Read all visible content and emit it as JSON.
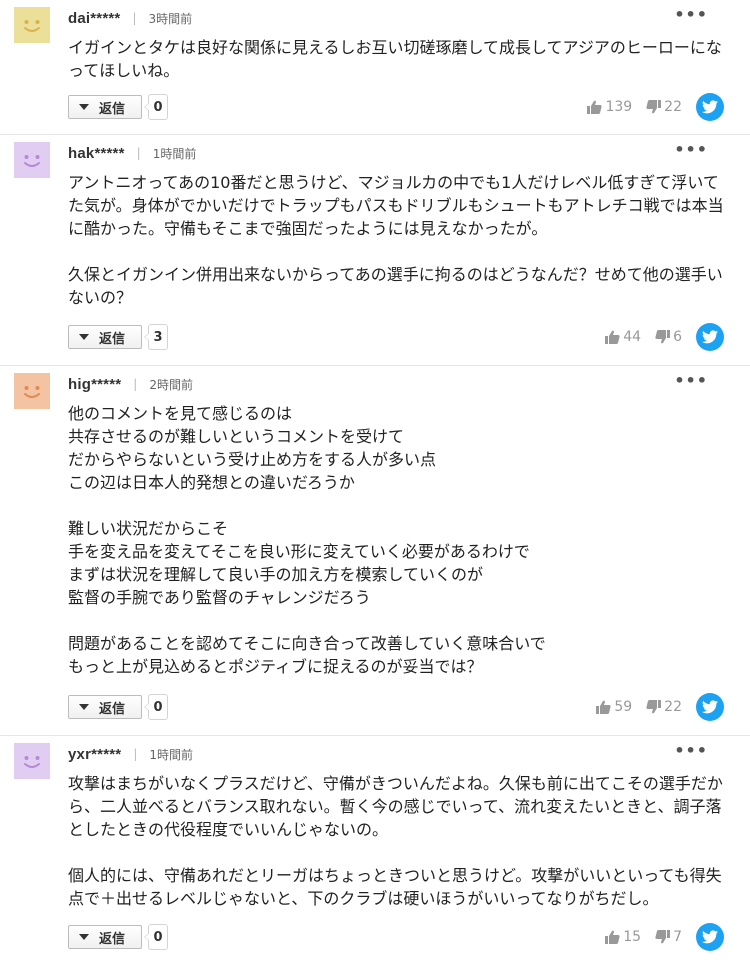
{
  "comments": [
    {
      "user": "dai*****",
      "time": "3時間前",
      "text": "イガインとタケは良好な関係に見えるしお互い切磋琢磨して成長してアジアのヒーローになってほしいね。",
      "reply_label": "返信",
      "reply_count": "0",
      "likes": "139",
      "dislikes": "22",
      "avatar_color": "#ecdf9a"
    },
    {
      "user": "hak*****",
      "time": "1時間前",
      "text": "アントニオってあの10番だと思うけど、マジョルカの中でも1人だけレベル低すぎて浮いてた気が。身体がでかいだけでトラップもパスもドリブルもシュートもアトレチコ戦では本当に酷かった。守備もそこまで強固だったようには見えなかったが。\n\n久保とイガンイン併用出来ないからってあの選手に拘るのはどうなんだ？せめて他の選手いないの？",
      "reply_label": "返信",
      "reply_count": "3",
      "likes": "44",
      "dislikes": "6",
      "avatar_color": "#e2cdf2"
    },
    {
      "user": "hig*****",
      "time": "2時間前",
      "text": "他のコメントを見て感じるのは\n共存させるのが難しいというコメントを受けて\nだからやらないという受け止め方をする人が多い点\nこの辺は日本人的発想との違いだろうか\n\n難しい状況だからこそ\n手を変え品を変えてそこを良い形に変えていく必要があるわけで\nまずは状況を理解して良い手の加え方を模索していくのが\n監督の手腕であり監督のチャレンジだろう\n\n問題があることを認めてそこに向き合って改善していく意味合いで\nもっと上が見込めるとポジティブに捉えるのが妥当では？",
      "reply_label": "返信",
      "reply_count": "0",
      "likes": "59",
      "dislikes": "22",
      "avatar_color": "#f3c3a3"
    },
    {
      "user": "yxr*****",
      "time": "1時間前",
      "text": "攻撃はまちがいなくプラスだけど、守備がきついんだよね。久保も前に出てこその選手だから、二人並べるとバランス取れない。暫く今の感じでいって、流れ変えたいときと、調子落としたときの代役程度でいいんじゃないの。\n\n個人的には、守備あれだとリーガはちょっときついと思うけど。攻撃がいいといっても得失点で＋出せるレベルじゃないと、下のクラブは硬いほうがいいってなりがちだし。",
      "reply_label": "返信",
      "reply_count": "0",
      "likes": "15",
      "dislikes": "7",
      "avatar_color": "#e2cdf2"
    }
  ],
  "icons": {
    "more": "more-options-icon",
    "like": "thumbs-up-icon",
    "dislike": "thumbs-down-icon",
    "share": "twitter-icon",
    "reply": "reply-dropdown-icon"
  },
  "colors": {
    "twitter": "#1da1f2",
    "vote_text": "#999999"
  }
}
